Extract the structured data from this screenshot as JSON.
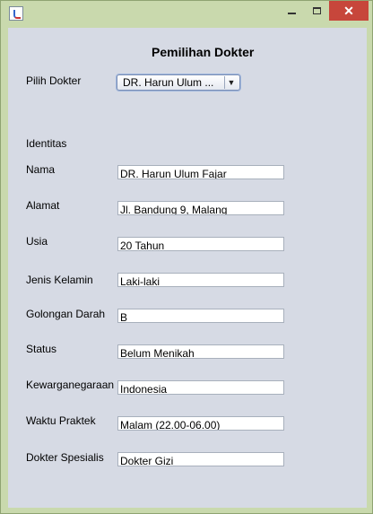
{
  "window": {
    "title": "",
    "minimize_icon": "minimize-icon",
    "maximize_icon": "maximize-icon",
    "close_symbol": "✕"
  },
  "form": {
    "heading": "Pemilihan Dokter",
    "selector_label": "Pilih Dokter",
    "selected_doctor": "DR. Harun Ulum ...",
    "section_label": "Identitas",
    "fields": [
      {
        "label": "Nama",
        "value": "DR. Harun Ulum Fajar"
      },
      {
        "label": "Alamat",
        "value": "Jl. Bandung 9, Malang"
      },
      {
        "label": "Usia",
        "value": "20 Tahun"
      },
      {
        "label": "Jenis Kelamin",
        "value": "Laki-laki"
      },
      {
        "label": "Golongan Darah",
        "value": "B"
      },
      {
        "label": "Status",
        "value": "Belum Menikah"
      },
      {
        "label": "Kewarganegaraan",
        "value": "Indonesia"
      },
      {
        "label": "Waktu Praktek",
        "value": "Malam (22.00-06.00)"
      },
      {
        "label": "Dokter Spesialis",
        "value": "Dokter Gizi"
      }
    ]
  }
}
